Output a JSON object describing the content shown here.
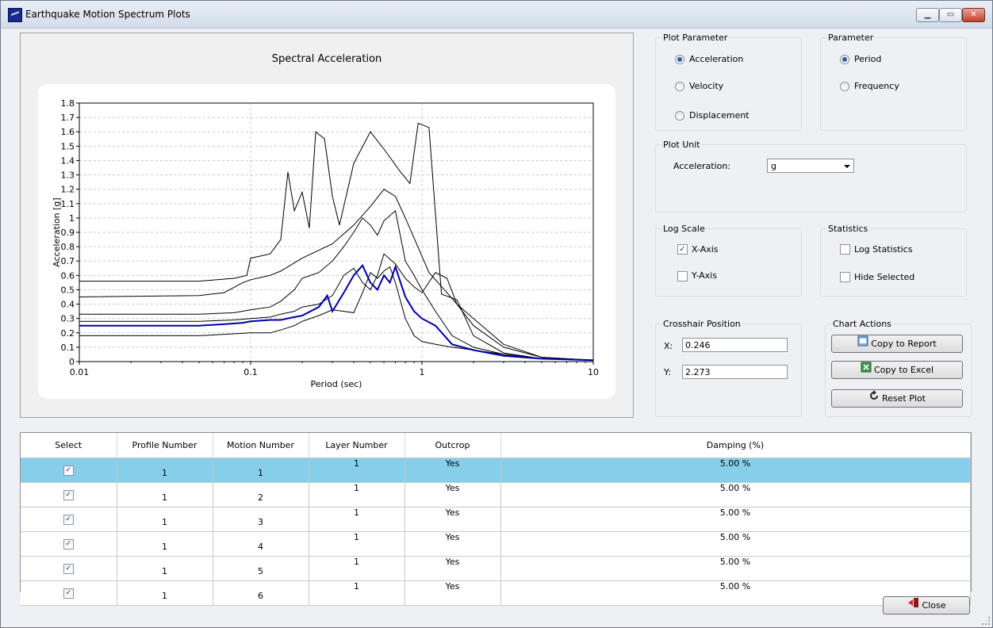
{
  "window": {
    "title": "Earthquake Motion Spectrum Plots",
    "min": "▁",
    "max": "▭",
    "close": "✕"
  },
  "chart_data": {
    "type": "line",
    "title": "Spectral Acceleration",
    "xlabel": "Period (sec)",
    "ylabel": "Acceleration [g]",
    "xscale": "log",
    "xlim": [
      0.01,
      10
    ],
    "ylim": [
      0,
      1.8
    ],
    "xticks": [
      "0.01",
      "0.1",
      "1",
      "10"
    ],
    "yticks": [
      "0",
      "0.1",
      "0.2",
      "0.3",
      "0.4",
      "0.5",
      "0.6",
      "0.7",
      "0.8",
      "0.9",
      "1",
      "1.1",
      "1.2",
      "1.3",
      "1.4",
      "1.5",
      "1.6",
      "1.7",
      "1.8"
    ],
    "grid": true,
    "series": [
      {
        "color": "#000000",
        "x": [
          0.01,
          0.05,
          0.08,
          0.095,
          0.1,
          0.13,
          0.15,
          0.165,
          0.18,
          0.2,
          0.22,
          0.24,
          0.27,
          0.3,
          0.33,
          0.4,
          0.5,
          0.6,
          0.75,
          0.85,
          0.95,
          1.1,
          1.3,
          1.6,
          2,
          3,
          5,
          10
        ],
        "y": [
          0.56,
          0.56,
          0.58,
          0.6,
          0.72,
          0.75,
          0.85,
          1.32,
          1.05,
          1.18,
          0.93,
          1.6,
          1.55,
          1.15,
          0.95,
          1.38,
          1.6,
          1.48,
          1.32,
          1.24,
          1.66,
          1.63,
          0.47,
          0.43,
          0.18,
          0.06,
          0.02,
          0.01
        ]
      },
      {
        "color": "#000000",
        "x": [
          0.01,
          0.05,
          0.07,
          0.09,
          0.1,
          0.13,
          0.15,
          0.2,
          0.3,
          0.4,
          0.5,
          0.6,
          0.7,
          0.8,
          0.9,
          1.1,
          1.4,
          1.6,
          2,
          3,
          5,
          10
        ],
        "y": [
          0.45,
          0.46,
          0.48,
          0.55,
          0.57,
          0.6,
          0.63,
          0.72,
          0.82,
          0.95,
          1.08,
          1.2,
          1.15,
          1.0,
          0.86,
          0.62,
          0.48,
          0.4,
          0.25,
          0.1,
          0.03,
          0.01
        ]
      },
      {
        "color": "#000000",
        "x": [
          0.01,
          0.05,
          0.08,
          0.1,
          0.13,
          0.15,
          0.18,
          0.2,
          0.25,
          0.3,
          0.35,
          0.4,
          0.45,
          0.5,
          0.55,
          0.6,
          0.7,
          0.8,
          0.9,
          1.0,
          1.2,
          1.5,
          2,
          3,
          5,
          10
        ],
        "y": [
          0.33,
          0.33,
          0.34,
          0.36,
          0.38,
          0.42,
          0.5,
          0.58,
          0.62,
          0.7,
          0.8,
          0.9,
          1.0,
          0.95,
          0.88,
          0.98,
          1.05,
          0.7,
          0.6,
          0.5,
          0.35,
          0.18,
          0.1,
          0.05,
          0.02,
          0.01
        ]
      },
      {
        "color": "#000000",
        "x": [
          0.01,
          0.05,
          0.08,
          0.1,
          0.13,
          0.15,
          0.18,
          0.2,
          0.25,
          0.3,
          0.35,
          0.4,
          0.45,
          0.5,
          0.55,
          0.6,
          0.7,
          0.8,
          0.9,
          1.0,
          1.2,
          1.4,
          1.6,
          2,
          3,
          5,
          10
        ],
        "y": [
          0.28,
          0.28,
          0.29,
          0.3,
          0.31,
          0.33,
          0.35,
          0.38,
          0.4,
          0.46,
          0.6,
          0.65,
          0.55,
          0.5,
          0.6,
          0.75,
          0.68,
          0.58,
          0.52,
          0.48,
          0.62,
          0.58,
          0.4,
          0.3,
          0.12,
          0.03,
          0.01
        ]
      },
      {
        "color": "#000000",
        "x": [
          0.01,
          0.05,
          0.1,
          0.13,
          0.15,
          0.18,
          0.2,
          0.25,
          0.3,
          0.35,
          0.4,
          0.45,
          0.5,
          0.55,
          0.6,
          0.65,
          0.7,
          0.8,
          0.9,
          1.0,
          1.2,
          1.5,
          2,
          3,
          5,
          10
        ],
        "y": [
          0.18,
          0.18,
          0.2,
          0.2,
          0.22,
          0.25,
          0.28,
          0.32,
          0.36,
          0.35,
          0.34,
          0.48,
          0.62,
          0.58,
          0.63,
          0.66,
          0.55,
          0.3,
          0.18,
          0.14,
          0.12,
          0.1,
          0.08,
          0.05,
          0.02,
          0.01
        ]
      },
      {
        "color": "#0000aa",
        "x": [
          0.01,
          0.05,
          0.07,
          0.09,
          0.1,
          0.13,
          0.15,
          0.18,
          0.2,
          0.25,
          0.28,
          0.3,
          0.35,
          0.4,
          0.45,
          0.5,
          0.55,
          0.6,
          0.65,
          0.7,
          0.8,
          0.9,
          1.0,
          1.2,
          1.5,
          2,
          3,
          5,
          10
        ],
        "y": [
          0.25,
          0.25,
          0.26,
          0.27,
          0.28,
          0.29,
          0.29,
          0.31,
          0.32,
          0.38,
          0.46,
          0.35,
          0.48,
          0.6,
          0.67,
          0.55,
          0.5,
          0.6,
          0.55,
          0.66,
          0.45,
          0.35,
          0.3,
          0.25,
          0.12,
          0.08,
          0.04,
          0.02,
          0.01
        ]
      }
    ]
  },
  "plot_parameter": {
    "label": "Plot Parameter",
    "options": [
      "Acceleration",
      "Velocity",
      "Displacement"
    ],
    "selected": "Acceleration"
  },
  "parameter": {
    "label": "Parameter",
    "options": [
      "Period",
      "Frequency"
    ],
    "selected": "Period"
  },
  "plot_unit": {
    "label": "Plot Unit",
    "field_label": "Acceleration:",
    "value": "g"
  },
  "log_scale": {
    "label": "Log Scale",
    "x_axis": "X-Axis",
    "y_axis": "Y-Axis"
  },
  "statistics": {
    "label": "Statistics",
    "log_statistics": "Log Statistics",
    "hide_selected": "Hide Selected"
  },
  "crosshair": {
    "label": "Crosshair Position",
    "x_label": "X:",
    "x_value": "0.246",
    "y_label": "Y:",
    "y_value": "2.273"
  },
  "chart_actions": {
    "label": "Chart Actions",
    "copy_report": "Copy to Report",
    "copy_excel": "Copy to Excel",
    "reset_plot": "Reset Plot"
  },
  "table": {
    "headers": [
      "Select",
      "Profile Number",
      "Motion Number",
      "Layer Number",
      "Outcrop",
      "Damping (%)"
    ],
    "rows": [
      [
        "1",
        "1",
        "1",
        "Yes",
        "5.00 %"
      ],
      [
        "1",
        "2",
        "1",
        "Yes",
        "5.00 %"
      ],
      [
        "1",
        "3",
        "1",
        "Yes",
        "5.00 %"
      ],
      [
        "1",
        "4",
        "1",
        "Yes",
        "5.00 %"
      ],
      [
        "1",
        "5",
        "1",
        "Yes",
        "5.00 %"
      ],
      [
        "1",
        "6",
        "1",
        "Yes",
        "5.00 %"
      ]
    ]
  },
  "close_button": "Close"
}
